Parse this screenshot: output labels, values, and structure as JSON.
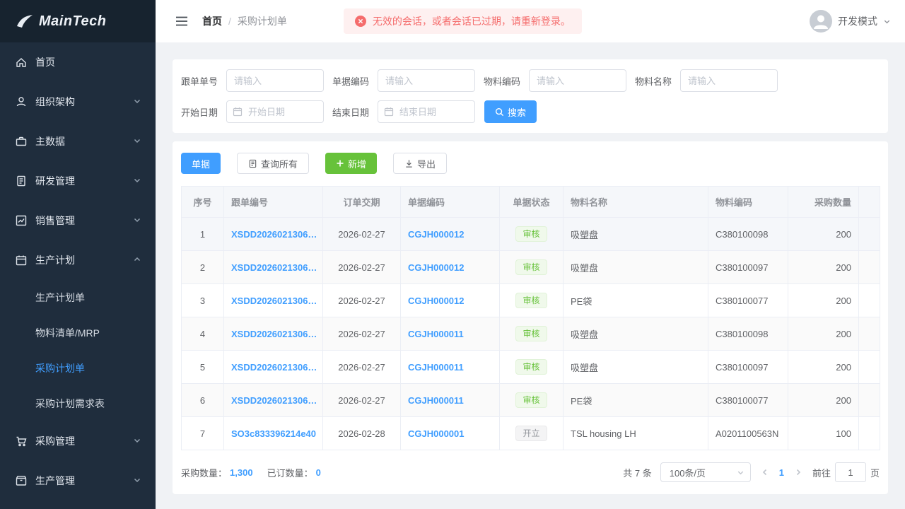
{
  "colors": {
    "primary": "#409eff",
    "success": "#67c23a",
    "danger": "#f56c6c",
    "sidebar_bg": "#1f2d3d"
  },
  "app": {
    "logo_text": "MainTech"
  },
  "sidebar": {
    "items": [
      {
        "label": "首页"
      },
      {
        "label": "组织架构"
      },
      {
        "label": "主数据"
      },
      {
        "label": "研发管理"
      },
      {
        "label": "销售管理"
      },
      {
        "label": "生产计划"
      },
      {
        "label": "采购管理"
      },
      {
        "label": "生产管理"
      }
    ],
    "production_plan_children": [
      {
        "label": "生产计划单"
      },
      {
        "label": "物料清单/MRP"
      },
      {
        "label": "采购计划单"
      },
      {
        "label": "采购计划需求表"
      }
    ]
  },
  "header": {
    "breadcrumb_home": "首页",
    "breadcrumb_sep": "/",
    "breadcrumb_current": "采购计划单",
    "alert_text": "无效的会话，或者会话已过期，请重新登录。",
    "user_mode": "开发模式"
  },
  "filters": {
    "fields": [
      {
        "label": "跟单单号",
        "placeholder": "请输入"
      },
      {
        "label": "单据编码",
        "placeholder": "请输入"
      },
      {
        "label": "物料编码",
        "placeholder": "请输入"
      },
      {
        "label": "物料名称",
        "placeholder": "请输入"
      }
    ],
    "date_fields": [
      {
        "label": "开始日期",
        "placeholder": "开始日期"
      },
      {
        "label": "结束日期",
        "placeholder": "结束日期"
      }
    ],
    "search_label": "搜索"
  },
  "toolbar": {
    "doc_button": "单据",
    "query_all_button": "查询所有",
    "add_button": "新增",
    "export_button": "导出"
  },
  "table": {
    "columns": [
      "序号",
      "跟单编号",
      "订单交期",
      "单据编码",
      "单据状态",
      "物料名称",
      "物料编码",
      "采购数量"
    ],
    "rows": [
      {
        "idx": "1",
        "order_no": "XSDD2026021306…",
        "delivery": "2026-02-27",
        "doc_no": "CGJH000012",
        "status": "审核",
        "status_class": "tag tag-success",
        "material": "吸塑盘",
        "code": "C380100098",
        "qty": "200"
      },
      {
        "idx": "2",
        "order_no": "XSDD2026021306…",
        "delivery": "2026-02-27",
        "doc_no": "CGJH000012",
        "status": "审核",
        "status_class": "tag tag-success",
        "material": "吸塑盘",
        "code": "C380100097",
        "qty": "200"
      },
      {
        "idx": "3",
        "order_no": "XSDD2026021306…",
        "delivery": "2026-02-27",
        "doc_no": "CGJH000012",
        "status": "审核",
        "status_class": "tag tag-success",
        "material": "PE袋",
        "code": "C380100077",
        "qty": "200"
      },
      {
        "idx": "4",
        "order_no": "XSDD2026021306…",
        "delivery": "2026-02-27",
        "doc_no": "CGJH000011",
        "status": "审核",
        "status_class": "tag tag-success",
        "material": "吸塑盘",
        "code": "C380100098",
        "qty": "200"
      },
      {
        "idx": "5",
        "order_no": "XSDD2026021306…",
        "delivery": "2026-02-27",
        "doc_no": "CGJH000011",
        "status": "审核",
        "status_class": "tag tag-success",
        "material": "吸塑盘",
        "code": "C380100097",
        "qty": "200"
      },
      {
        "idx": "6",
        "order_no": "XSDD2026021306…",
        "delivery": "2026-02-27",
        "doc_no": "CGJH000011",
        "status": "审核",
        "status_class": "tag tag-success",
        "material": "PE袋",
        "code": "C380100077",
        "qty": "200"
      },
      {
        "idx": "7",
        "order_no": "SO3c833396214e40",
        "delivery": "2026-02-28",
        "doc_no": "CGJH000001",
        "status": "开立",
        "status_class": "tag tag-info",
        "material": "TSL housing LH",
        "code": "A0201100563N",
        "qty": "100"
      }
    ]
  },
  "footer": {
    "purchase_qty_label": "采购数量：",
    "purchase_qty_value": "1,300",
    "ordered_qty_label": "已订数量：",
    "ordered_qty_value": "0",
    "total_text": "共 7 条",
    "page_size": "100条/页",
    "current_page": "1",
    "goto_label": "前往",
    "goto_value": "1",
    "page_unit": "页"
  }
}
